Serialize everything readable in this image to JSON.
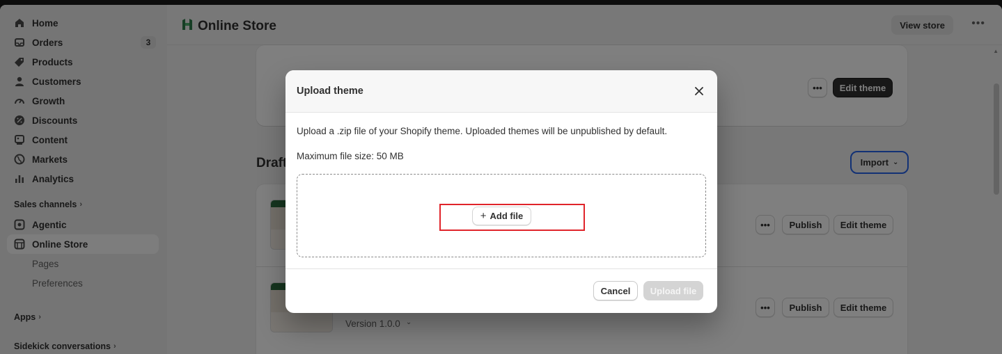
{
  "sidebar": {
    "items": [
      {
        "label": "Home",
        "icon": "home-icon"
      },
      {
        "label": "Orders",
        "icon": "orders-icon",
        "badge": "3"
      },
      {
        "label": "Products",
        "icon": "tag-icon"
      },
      {
        "label": "Customers",
        "icon": "person-icon"
      },
      {
        "label": "Growth",
        "icon": "gauge-icon"
      },
      {
        "label": "Discounts",
        "icon": "discount-icon"
      },
      {
        "label": "Content",
        "icon": "content-icon"
      },
      {
        "label": "Markets",
        "icon": "globe-icon"
      },
      {
        "label": "Analytics",
        "icon": "bar-chart-icon"
      }
    ],
    "sales_channels": "Sales channels",
    "channels": [
      {
        "label": "Agentic",
        "icon": "agentic-icon"
      },
      {
        "label": "Online Store",
        "icon": "store-icon",
        "active": true
      }
    ],
    "sub_items": [
      "Pages",
      "Preferences"
    ],
    "apps": "Apps",
    "sidekick": "Sidekick conversations"
  },
  "header": {
    "title": "Online Store",
    "view_store": "View store"
  },
  "background": {
    "edit_theme": "Edit theme",
    "section_title": "Drafts",
    "import": "Import",
    "publish": "Publish",
    "version": "Version 1.0.0"
  },
  "modal": {
    "title": "Upload theme",
    "description": "Upload a .zip file of your Shopify theme. Uploaded themes will be unpublished by default.",
    "max_size": "Maximum file size: 50 MB",
    "add_file": "Add file",
    "cancel": "Cancel",
    "upload": "Upload file"
  },
  "colors": {
    "highlight": "#e0242a",
    "focus_ring": "#2563eb",
    "primary_dark": "#303030"
  }
}
